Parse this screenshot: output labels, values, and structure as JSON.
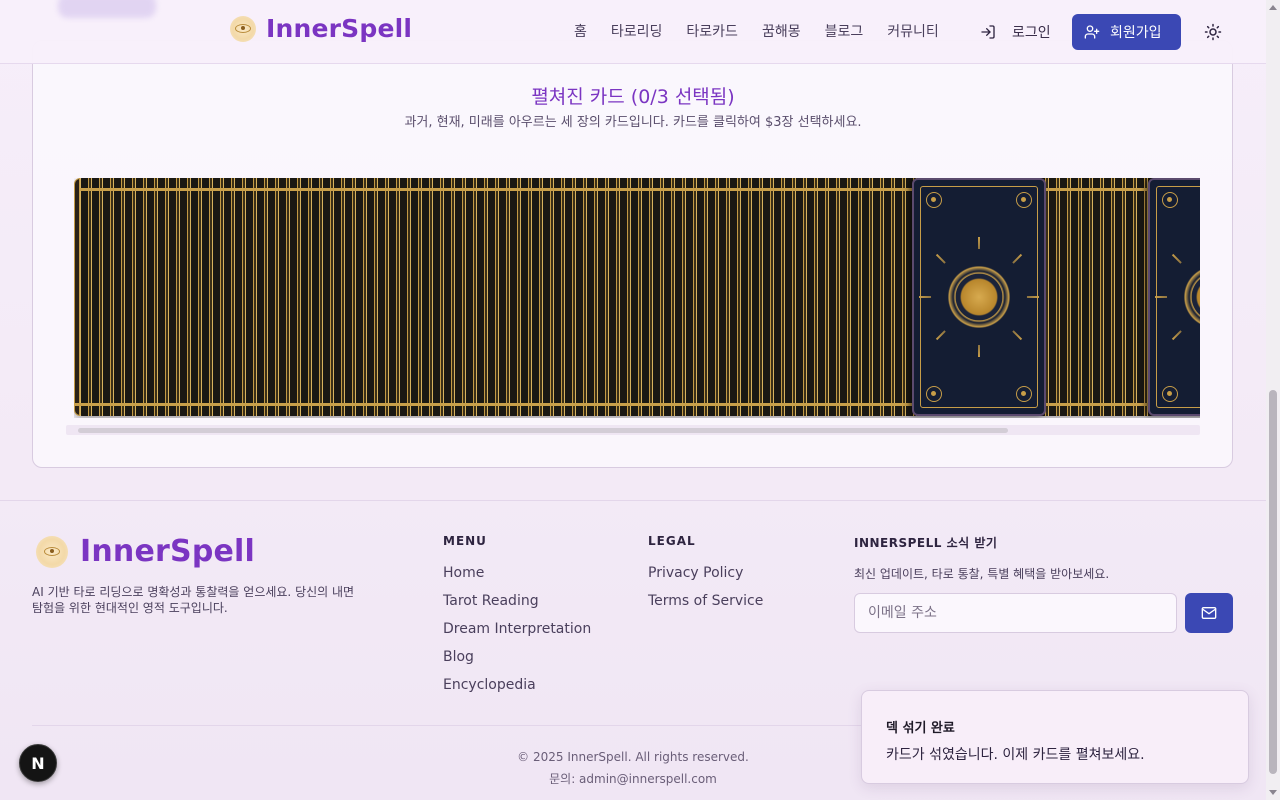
{
  "header": {
    "logo_text": "InnerSpell",
    "nav": [
      "홈",
      "타로리딩",
      "타로카드",
      "꿈해몽",
      "블로그",
      "커뮤니티"
    ],
    "login_label": "로그인",
    "signup_label": "회원가입"
  },
  "deck": {
    "title": "펼쳐진 카드 (0/3 선택됨)",
    "subtitle": "과거, 현재, 미래를 아우르는 세 장의 카드입니다. 카드를 클릭하여 $3장 선택하세요.",
    "selected_count": 0,
    "required_count": 3
  },
  "footer": {
    "logo_text": "InnerSpell",
    "description": "AI 기반 타로 리딩으로 명확성과 통찰력을 얻으세요. 당신의 내면 탐험을 위한 현대적인 영적 도구입니다.",
    "menu_heading": "MENU",
    "menu_items": [
      "Home",
      "Tarot Reading",
      "Dream Interpretation",
      "Blog",
      "Encyclopedia"
    ],
    "legal_heading": "LEGAL",
    "legal_items": [
      "Privacy Policy",
      "Terms of Service"
    ],
    "newsletter_heading": "INNERSPELL 소식 받기",
    "newsletter_desc": "최신 업데이트, 타로 통찰, 특별 혜택을 받아보세요.",
    "email_placeholder": "이메일 주소",
    "copyright": "© 2025 InnerSpell. All rights reserved.",
    "contact": "문의: admin@innerspell.com"
  },
  "toast": {
    "title": "덱 섞기 완료",
    "message": "카드가 섞였습니다. 이제 카드를 펼쳐보세요."
  },
  "dev_badge": "N",
  "colors": {
    "brand_purple": "#7b35c2",
    "button_blue": "#3b48b4",
    "card_gold": "#c79d48",
    "card_navy": "#141d33"
  }
}
